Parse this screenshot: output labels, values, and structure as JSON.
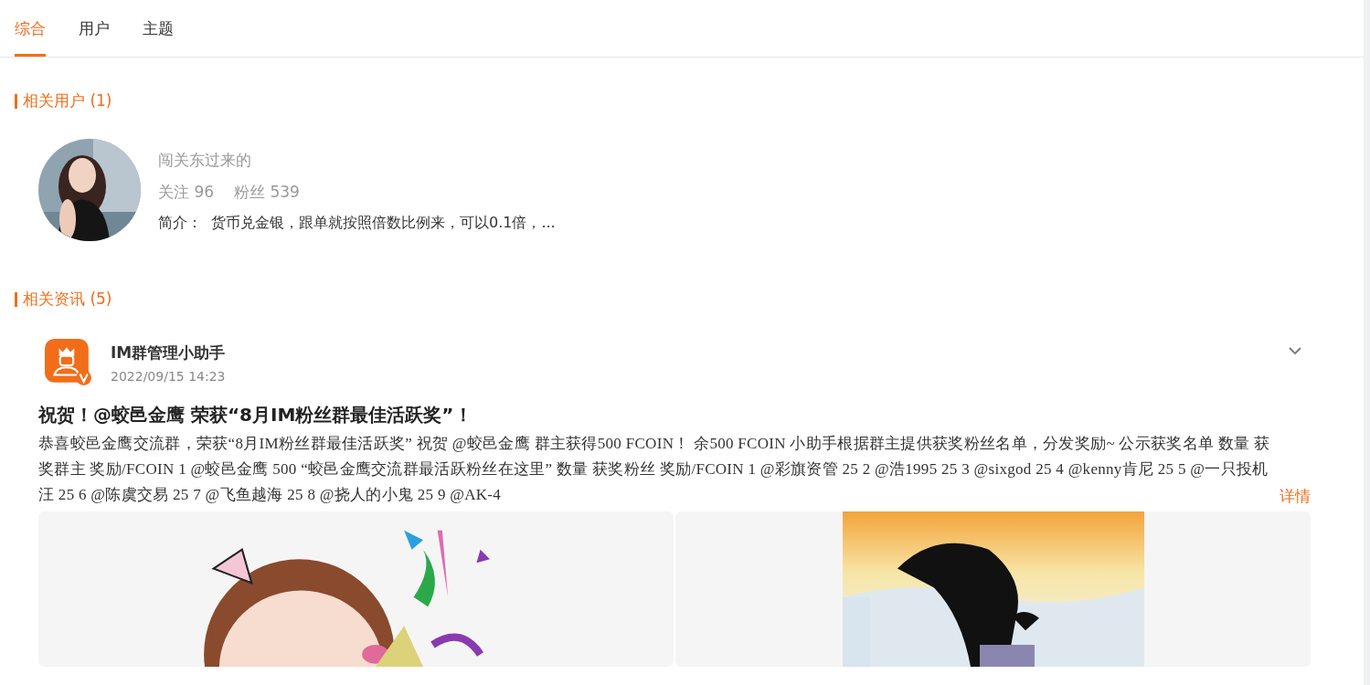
{
  "tabs": [
    {
      "label": "综合",
      "selected": true
    },
    {
      "label": "用户",
      "selected": false
    },
    {
      "label": "主题",
      "selected": false
    }
  ],
  "users_section": {
    "title": "相关用户 (1)",
    "users": [
      {
        "name": "闯关东过来的",
        "following_label": "关注",
        "following": "96",
        "followers_label": "粉丝",
        "followers": "539",
        "bio_label": "简介：",
        "bio": "货币兑金银，跟单就按照倍数比例来，可以0.1倍，..."
      }
    ]
  },
  "news_section": {
    "title": "相关资讯 (5)",
    "posts": [
      {
        "author": "IM群管理小助手",
        "verified": true,
        "time": "2022/09/15 14:23",
        "title": "祝贺！@蛟邑金鹰 荣获“8月IM粉丝群最佳活跃奖”！",
        "body": "恭喜蛟邑金鹰交流群，荣获“8月IM粉丝群最佳活跃奖” 祝贺 @蛟邑金鹰 群主获得500 FCOIN！ 余500 FCOIN 小助手根据群主提供获奖粉丝名单，分发奖励~ 公示获奖名单 数量 获奖群主 奖励/FCOIN 1 @蛟邑金鹰 500 “蛟邑金鹰交流群最活跃粉丝在这里” 数量 获奖粉丝 奖励/FCOIN 1 @彩旗资管 25 2 @浩1995 25 3 @sixgod 25 4 @kenny肯尼 25 5 @一只投机汪 25 6 @陈虞交易 25 7 @飞鱼越海 25 8 @挠人的小鬼 25 9 @AK-4",
        "more": "详情"
      }
    ]
  }
}
